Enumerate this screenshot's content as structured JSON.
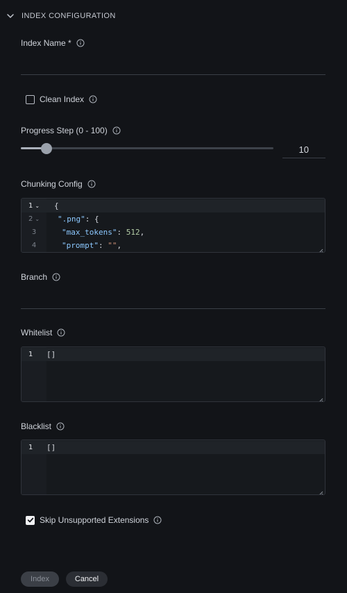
{
  "section": {
    "title": "INDEX CONFIGURATION"
  },
  "fields": {
    "index_name": {
      "label": "Index Name *",
      "value": ""
    },
    "clean_index": {
      "label": "Clean Index",
      "checked": false
    },
    "progress_step": {
      "label": "Progress Step (0 - 100)",
      "value": "10",
      "fraction": 0.1
    },
    "chunking_config": {
      "label": "Chunking Config",
      "lines": [
        {
          "num": "1",
          "text": "{"
        },
        {
          "num": "2",
          "key": "\".png\"",
          "rest": ": {"
        },
        {
          "num": "3",
          "key": "\"max_tokens\"",
          "sep": ": ",
          "num_val": "512",
          "rest": ","
        },
        {
          "num": "4",
          "key": "\"prompt\"",
          "sep": ": ",
          "str_val": "\"\"",
          "rest": ","
        }
      ]
    },
    "branch": {
      "label": "Branch",
      "value": ""
    },
    "whitelist": {
      "label": "Whitelist",
      "line_num": "1",
      "text": "[]"
    },
    "blacklist": {
      "label": "Blacklist",
      "line_num": "1",
      "text": "[]"
    },
    "skip_unsupported": {
      "label": "Skip Unsupported Extensions",
      "checked": true
    }
  },
  "buttons": {
    "index": "Index",
    "cancel": "Cancel"
  },
  "colors": {
    "background": "#121418",
    "json_key": "#8cc8ff",
    "json_number": "#b5cea8",
    "json_string": "#ce9178"
  }
}
